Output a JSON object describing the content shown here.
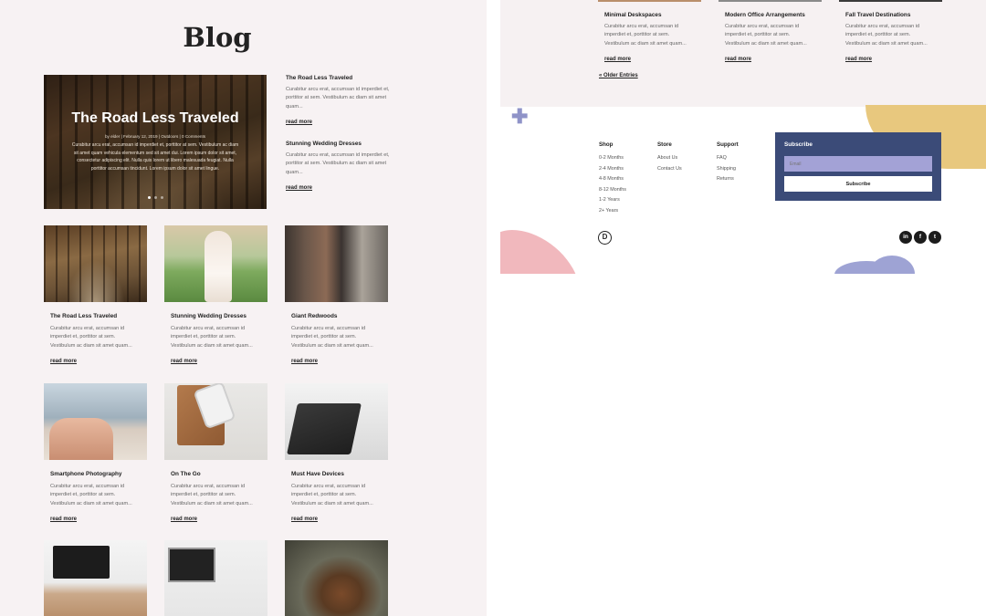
{
  "blog": {
    "title": "Blog",
    "hero": {
      "title": "The Road Less Traveled",
      "meta": "by elder | February 12, 2019 | Outdoors | 0 Comments",
      "excerpt": "Curabitur arcu erat, accumsan id imperdiet et, porttitor at sem. Vestibulum ac diam sit amet quam vehicula elementum sed sit amet dui. Lorem ipsum dolor sit amet, consectetur adipiscing elit. Nulla quis lorem ut libero malesuada feugiat. Nulla porttitor accumsan tincidunt. Lorem ipsum dolor sit amet lingue.",
      "slide_count": 3,
      "active_slide": 1
    },
    "side_posts": [
      {
        "title": "The Road Less Traveled",
        "excerpt": "Curabitur arcu erat, accumsan id imperdiet et, porttitor at sem. Vestibulum ac diam sit amet quam...",
        "read_more": "read more"
      },
      {
        "title": "Stunning Wedding Dresses",
        "excerpt": "Curabitur arcu erat, accumsan id imperdiet et, porttitor at sem. Vestibulum ac diam sit amet quam...",
        "read_more": "read more"
      }
    ],
    "grid_posts": [
      {
        "title": "The Road Less Traveled",
        "excerpt": "Curabitur arcu erat, accumsan id imperdiet et, porttitor at sem. Vestibulum ac diam sit amet quam...",
        "read_more": "read more"
      },
      {
        "title": "Stunning Wedding Dresses",
        "excerpt": "Curabitur arcu erat, accumsan id imperdiet et, porttitor at sem. Vestibulum ac diam sit amet quam...",
        "read_more": "read more"
      },
      {
        "title": "Giant Redwoods",
        "excerpt": "Curabitur arcu erat, accumsan id imperdiet et, porttitor at sem. Vestibulum ac diam sit amet quam...",
        "read_more": "read more"
      },
      {
        "title": "Smartphone Photography",
        "excerpt": "Curabitur arcu erat, accumsan id imperdiet et, porttitor at sem. Vestibulum ac diam sit amet quam...",
        "read_more": "read more"
      },
      {
        "title": "On The Go",
        "excerpt": "Curabitur arcu erat, accumsan id imperdiet et, porttitor at sem. Vestibulum ac diam sit amet quam...",
        "read_more": "read more"
      },
      {
        "title": "Must Have Devices",
        "excerpt": "Curabitur arcu erat, accumsan id imperdiet et, porttitor at sem. Vestibulum ac diam sit amet quam...",
        "read_more": "read more"
      }
    ]
  },
  "archive": {
    "posts": [
      {
        "title": "Minimal Deskspaces",
        "excerpt": "Curabitur arcu erat, accumsan id imperdiet et, porttitor at sem. Vestibulum ac diam sit amet quam...",
        "read_more": "read more"
      },
      {
        "title": "Modern Office Arrangements",
        "excerpt": "Curabitur arcu erat, accumsan id imperdiet et, porttitor at sem. Vestibulum ac diam sit amet quam...",
        "read_more": "read more"
      },
      {
        "title": "Fall Travel Destinations",
        "excerpt": "Curabitur arcu erat, accumsan id imperdiet et, porttitor at sem. Vestibulum ac diam sit amet quam...",
        "read_more": "read more"
      }
    ],
    "older_entries": "« Older Entries"
  },
  "footer": {
    "columns": [
      {
        "heading": "Shop",
        "links": [
          "0-2 Months",
          "2-4 Months",
          "4-8 Months",
          "8-12 Months",
          "1-2 Years",
          "2+ Years"
        ]
      },
      {
        "heading": "Store",
        "links": [
          "About Us",
          "Contact Us"
        ]
      },
      {
        "heading": "Support",
        "links": [
          "FAQ",
          "Shipping",
          "Returns"
        ]
      }
    ],
    "subscribe": {
      "title": "Subscribe",
      "email_placeholder": "Email",
      "button_label": "Subscribe"
    },
    "logo_letter": "D",
    "social": [
      {
        "name": "instagram-icon",
        "glyph": "in"
      },
      {
        "name": "facebook-icon",
        "glyph": "f"
      },
      {
        "name": "twitter-icon",
        "glyph": "t"
      }
    ]
  },
  "colors": {
    "page_bg": "#f7f2f3",
    "subscribe_bg": "#3b4b78",
    "email_field": "#a3a2d6",
    "accent_yellow": "#e8c87e",
    "accent_pink": "#f1b8bd",
    "accent_lilac": "#9ea3d4"
  }
}
